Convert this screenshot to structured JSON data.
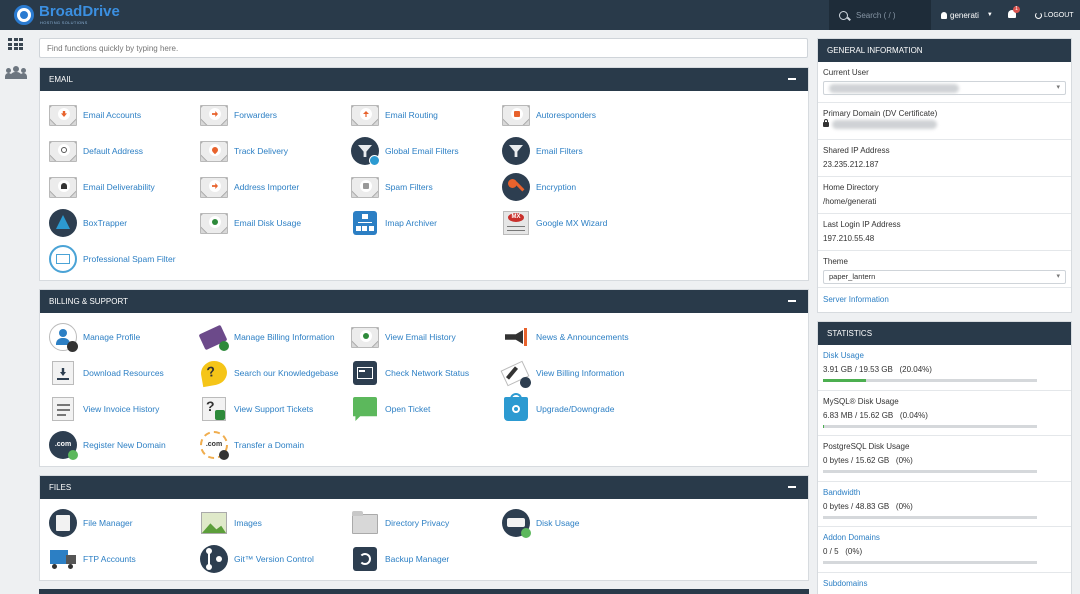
{
  "brand": {
    "name": "BroadDrive",
    "tagline": "HOSTING SOLUTIONS"
  },
  "topbar": {
    "search_placeholder": "Search ( / )",
    "username": "generati",
    "notifications": "1",
    "logout": "LOGOUT"
  },
  "quickfind": {
    "placeholder": "Find functions quickly by typing here."
  },
  "sections": {
    "email": {
      "title": "EMAIL",
      "items": [
        {
          "label": "Email Accounts",
          "icon": "email-accounts-icon"
        },
        {
          "label": "Forwarders",
          "icon": "forwarders-icon"
        },
        {
          "label": "Email Routing",
          "icon": "email-routing-icon"
        },
        {
          "label": "Autoresponders",
          "icon": "autoresponders-icon"
        },
        {
          "label": "Default Address",
          "icon": "default-address-icon"
        },
        {
          "label": "Track Delivery",
          "icon": "track-delivery-icon"
        },
        {
          "label": "Global Email Filters",
          "icon": "global-filter-icon"
        },
        {
          "label": "Email Filters",
          "icon": "email-filter-icon"
        },
        {
          "label": "Email Deliverability",
          "icon": "deliverability-icon"
        },
        {
          "label": "Address Importer",
          "icon": "address-importer-icon"
        },
        {
          "label": "Spam Filters",
          "icon": "spam-filters-icon"
        },
        {
          "label": "Encryption",
          "icon": "encryption-key-icon"
        },
        {
          "label": "BoxTrapper",
          "icon": "boxtrapper-icon"
        },
        {
          "label": "Email Disk Usage",
          "icon": "email-disk-usage-icon"
        },
        {
          "label": "Imap Archiver",
          "icon": "imap-archiver-icon"
        },
        {
          "label": "Google MX Wizard",
          "icon": "google-mx-icon"
        },
        {
          "label": "Professional Spam Filter",
          "icon": "professional-spam-icon"
        }
      ]
    },
    "billing": {
      "title": "BILLING & SUPPORT",
      "items": [
        {
          "label": "Manage Profile",
          "icon": "manage-profile-icon"
        },
        {
          "label": "Manage Billing Information",
          "icon": "billing-card-icon"
        },
        {
          "label": "View Email History",
          "icon": "email-history-icon"
        },
        {
          "label": "News & Announcements",
          "icon": "megaphone-icon"
        },
        {
          "label": "Download Resources",
          "icon": "download-icon"
        },
        {
          "label": "Search our Knowledgebase",
          "icon": "knowledgebase-icon"
        },
        {
          "label": "Check Network Status",
          "icon": "network-status-icon"
        },
        {
          "label": "View Billing Information",
          "icon": "billing-info-icon"
        },
        {
          "label": "View Invoice History",
          "icon": "invoice-icon"
        },
        {
          "label": "View Support Tickets",
          "icon": "support-tickets-icon"
        },
        {
          "label": "Open Ticket",
          "icon": "open-ticket-icon"
        },
        {
          "label": "Upgrade/Downgrade",
          "icon": "upgrade-icon"
        },
        {
          "label": "Register New Domain",
          "icon": "register-domain-icon"
        },
        {
          "label": "Transfer a Domain",
          "icon": "transfer-domain-icon"
        }
      ]
    },
    "files": {
      "title": "FILES",
      "items": [
        {
          "label": "File Manager",
          "icon": "file-manager-icon"
        },
        {
          "label": "Images",
          "icon": "images-icon"
        },
        {
          "label": "Directory Privacy",
          "icon": "directory-privacy-icon"
        },
        {
          "label": "Disk Usage",
          "icon": "disk-usage-icon"
        },
        {
          "label": "FTP Accounts",
          "icon": "ftp-accounts-icon"
        },
        {
          "label": "Git™ Version Control",
          "icon": "git-icon"
        },
        {
          "label": "Backup Manager",
          "icon": "backup-icon"
        }
      ]
    }
  },
  "general_info": {
    "title": "GENERAL INFORMATION",
    "current_user_label": "Current User",
    "primary_domain_label": "Primary Domain (DV Certificate)",
    "shared_ip_label": "Shared IP Address",
    "shared_ip": "23.235.212.187",
    "home_dir_label": "Home Directory",
    "home_dir": "/home/generati",
    "last_login_label": "Last Login IP Address",
    "last_login": "197.210.55.48",
    "theme_label": "Theme",
    "theme": "paper_lantern",
    "server_info": "Server Information"
  },
  "statistics": {
    "title": "STATISTICS",
    "rows": [
      {
        "label": "Disk Usage",
        "value": "3.91 GB / 19.53 GB   (20.04%)",
        "link": true,
        "fraction": 0.2004
      },
      {
        "label": "MySQL® Disk Usage",
        "value": "6.83 MB / 15.62 GB   (0.04%)",
        "link": false,
        "fraction": 0.0004
      },
      {
        "label": "PostgreSQL Disk Usage",
        "value": "0 bytes / 15.62 GB   (0%)",
        "link": false,
        "fraction": 0
      },
      {
        "label": "Bandwidth",
        "value": "0 bytes / 48.83 GB   (0%)",
        "link": true,
        "fraction": 0
      },
      {
        "label": "Addon Domains",
        "value": "0 / 5   (0%)",
        "link": true,
        "fraction": 0
      },
      {
        "label": "Subdomains",
        "value": "",
        "link": true,
        "fraction": 0
      }
    ]
  },
  "colors": {
    "header": "#293a4a",
    "link": "#2c7fc4",
    "accent": "#2a7bd1"
  }
}
